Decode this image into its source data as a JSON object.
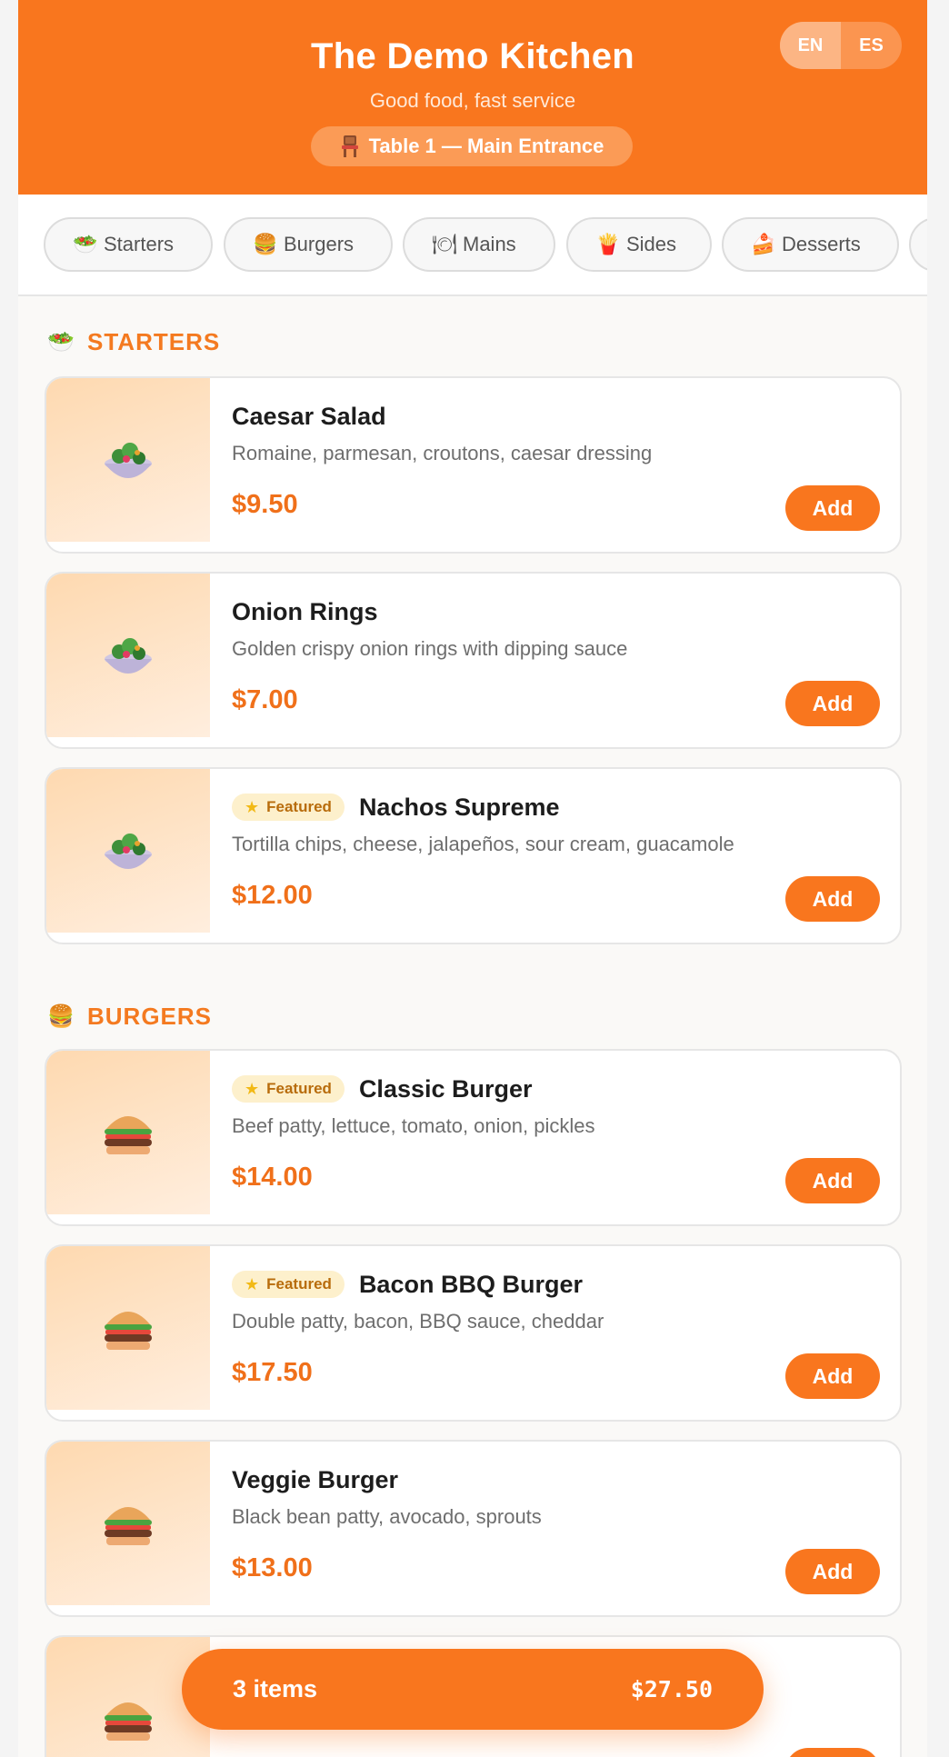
{
  "header": {
    "title": "The Demo Kitchen",
    "subtitle": "Good food, fast service",
    "table_label": "Table 1 — Main Entrance",
    "table_icon": "chair-icon",
    "languages": [
      {
        "code": "EN",
        "active": true
      },
      {
        "code": "ES",
        "active": false
      }
    ]
  },
  "categories": [
    {
      "icon": "🥗",
      "label": "Starters"
    },
    {
      "icon": "🍔",
      "label": "Burgers"
    },
    {
      "icon": "🍽",
      "label": "Mains"
    },
    {
      "icon": "🍟",
      "label": "Sides"
    },
    {
      "icon": "🍰",
      "label": "Desserts"
    }
  ],
  "sections": {
    "starters": {
      "icon": "🥗",
      "title": "STARTERS",
      "items": [
        {
          "name": "Caesar Salad",
          "desc": "Romaine, parmesan, croutons, caesar dressing",
          "price": "$9.50",
          "featured": false,
          "add": "Add"
        },
        {
          "name": "Onion Rings",
          "desc": "Golden crispy onion rings with dipping sauce",
          "price": "$7.00",
          "featured": false,
          "add": "Add"
        },
        {
          "name": "Nachos Supreme",
          "desc": "Tortilla chips, cheese, jalapeños, sour cream, guacamole",
          "price": "$12.00",
          "featured": true,
          "add": "Add"
        }
      ]
    },
    "burgers": {
      "icon": "🍔",
      "title": "BURGERS",
      "items": [
        {
          "name": "Classic Burger",
          "desc": "Beef patty, lettuce, tomato, onion, pickles",
          "price": "$14.00",
          "featured": true,
          "add": "Add"
        },
        {
          "name": "Bacon BBQ Burger",
          "desc": "Double patty, bacon, BBQ sauce, cheddar",
          "price": "$17.50",
          "featured": true,
          "add": "Add"
        },
        {
          "name": "Veggie Burger",
          "desc": "Black bean patty, avocado, sprouts",
          "price": "$13.00",
          "featured": false,
          "add": "Add"
        }
      ]
    }
  },
  "featured_label": "Featured",
  "cart": {
    "count": "3 items",
    "total": "$27.50"
  },
  "colors": {
    "accent": "#f9761e",
    "price": "#f0701a",
    "badge_bg": "#fdf0cc"
  }
}
